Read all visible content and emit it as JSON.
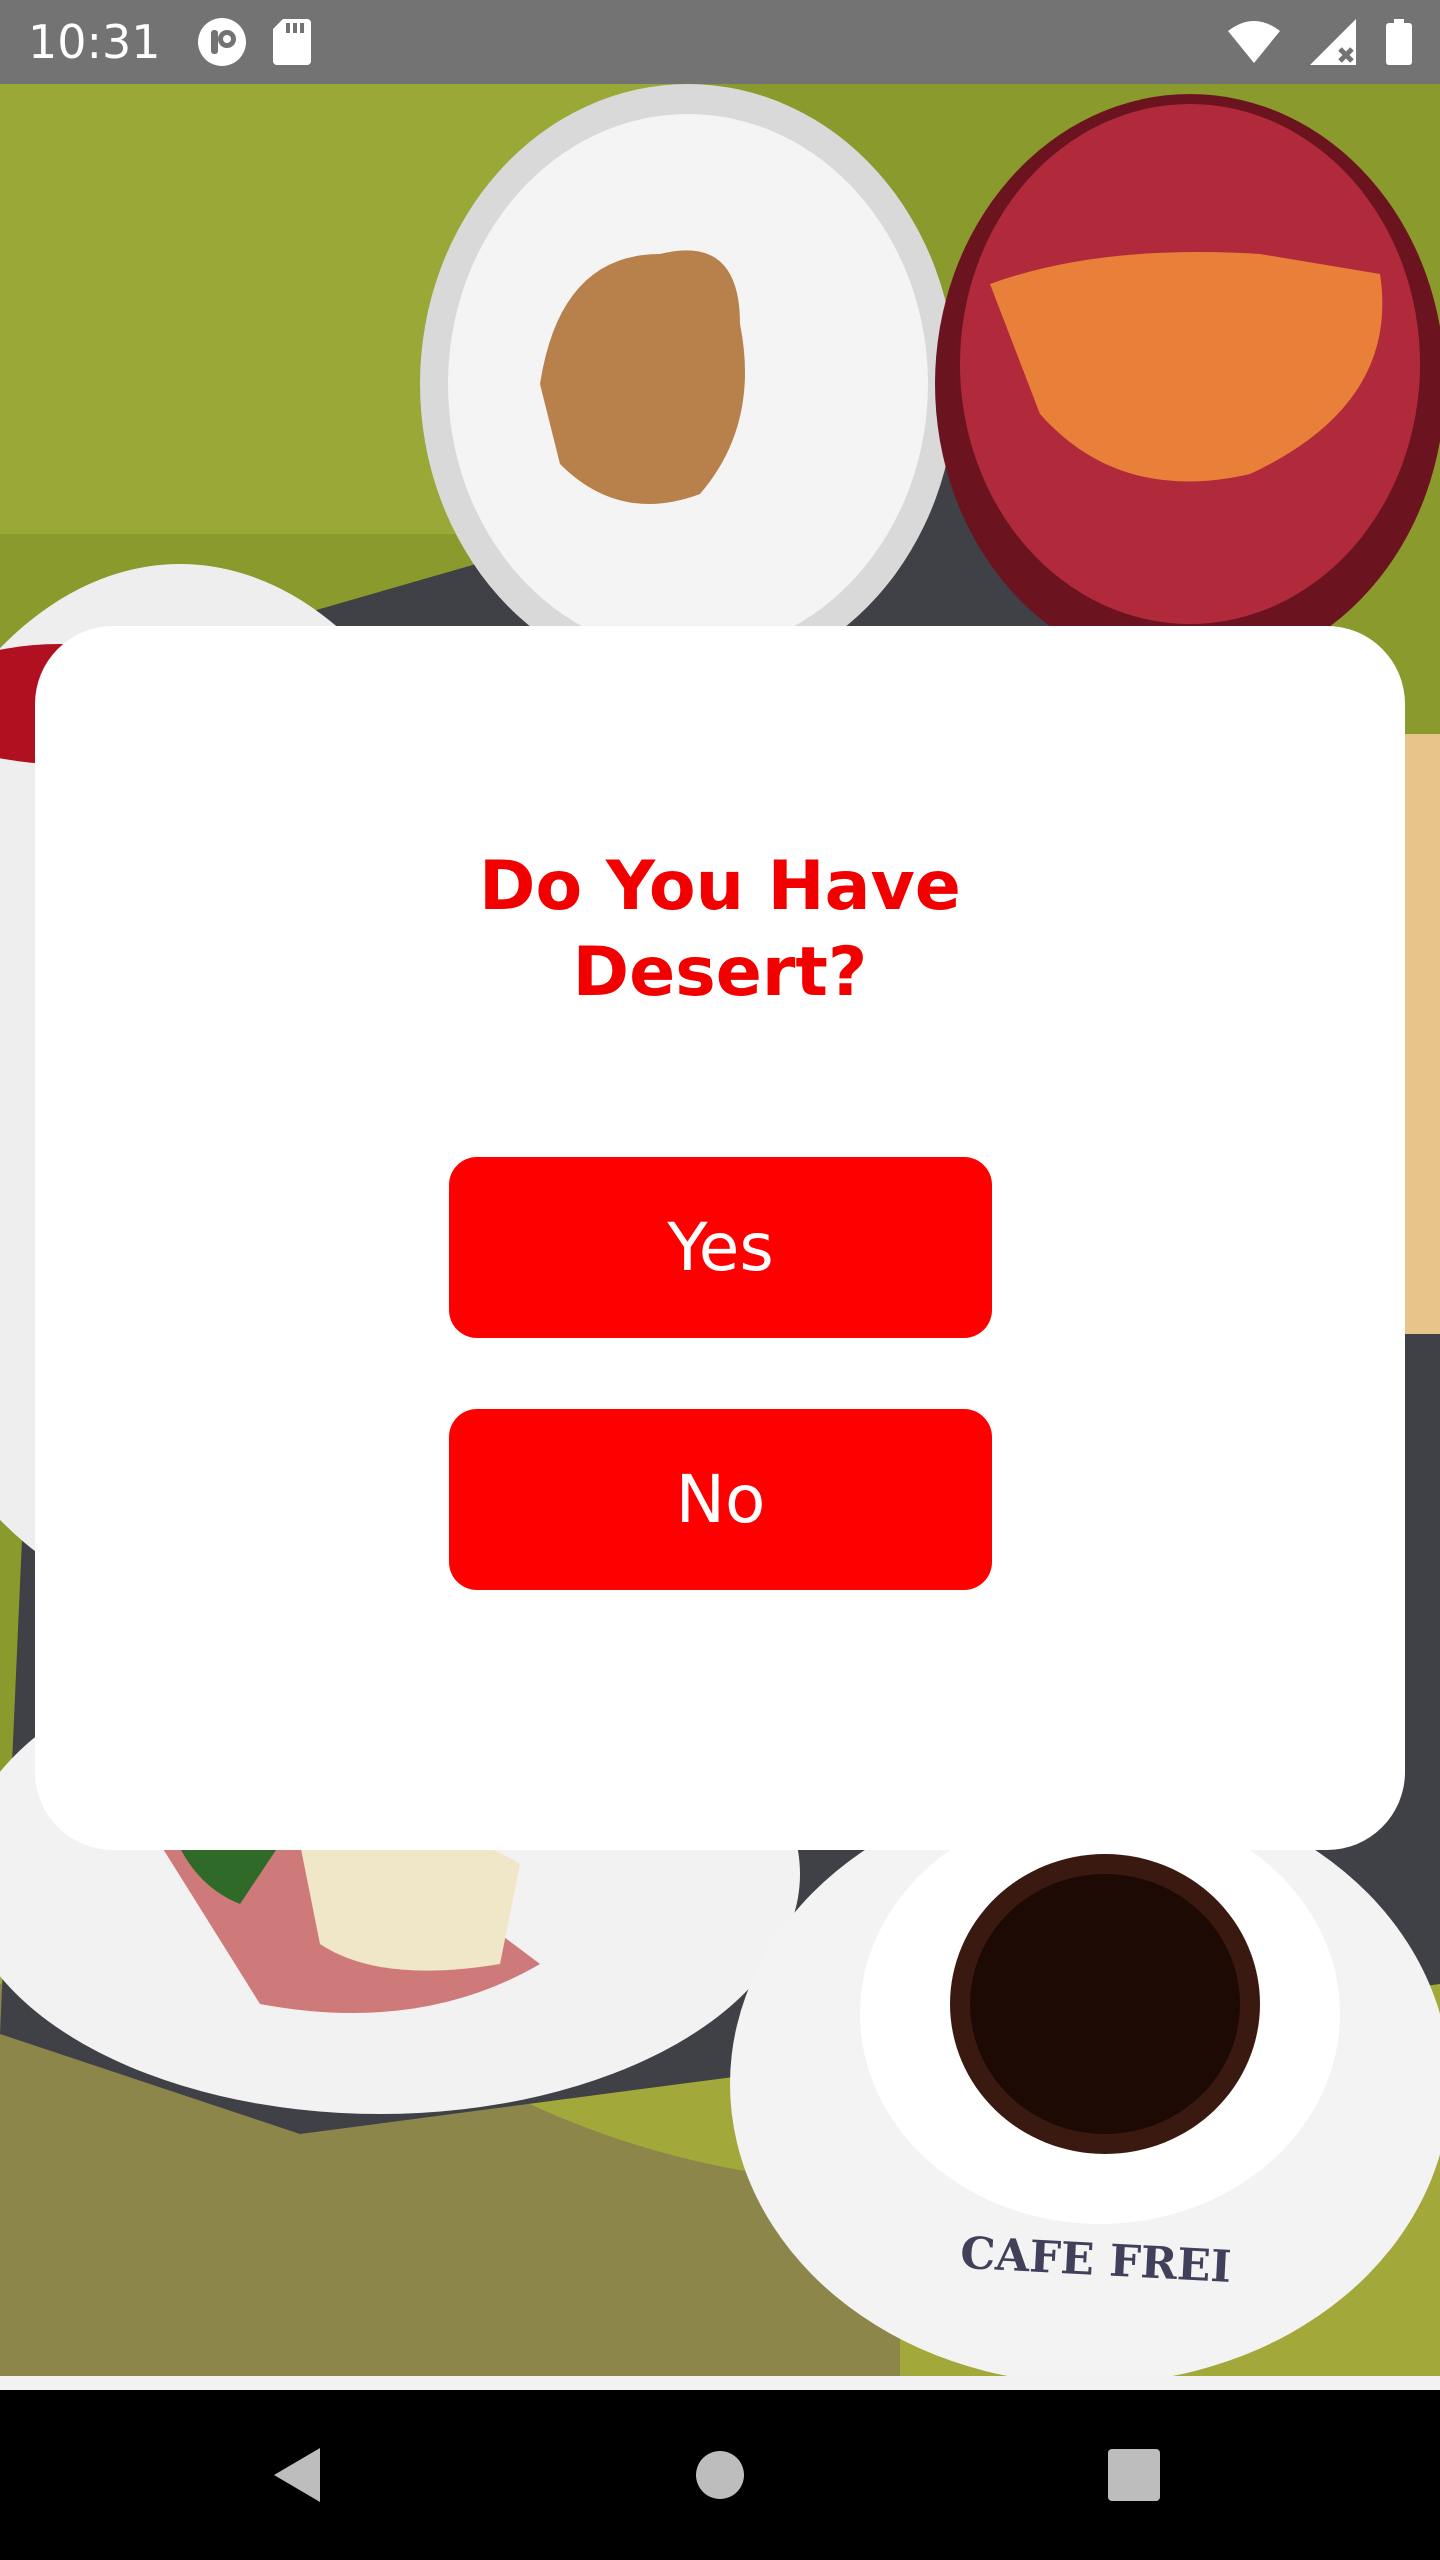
{
  "status_bar": {
    "time": "10:31",
    "left_icons": [
      "notification-app-icon",
      "sd-card-icon"
    ],
    "right_icons": [
      "wifi-icon",
      "cell-signal-icon",
      "battery-icon"
    ]
  },
  "background": {
    "description_icon": "food-photo",
    "cup_label": "CAFE FREI"
  },
  "dialog": {
    "title_line1": "Do You Have",
    "title_line2": "Desert?",
    "yes_label": "Yes",
    "no_label": "No",
    "accent_color": "#ff0000",
    "title_color": "#f20000"
  },
  "nav_bar": {
    "items": [
      "back-icon",
      "home-icon",
      "recents-icon"
    ]
  }
}
